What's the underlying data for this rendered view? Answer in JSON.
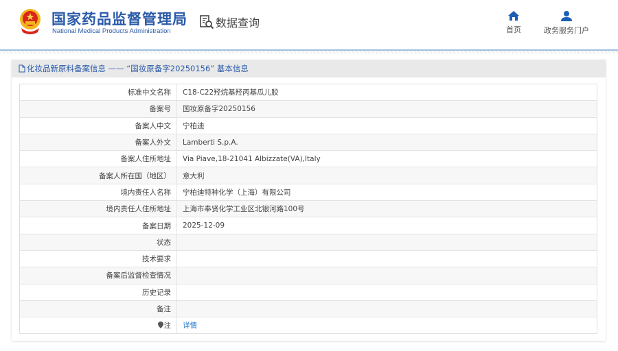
{
  "header": {
    "logo_cn": "国家药品监督管理局",
    "logo_en": "National Medical Products Administration",
    "query_label": "数据查询",
    "nav": [
      {
        "label": "首页",
        "icon": "home-icon"
      },
      {
        "label": "政务服务门户",
        "icon": "user-icon"
      }
    ]
  },
  "panel": {
    "title": "化妆品新原料备案信息 —— “国妆原备字20250156” 基本信息"
  },
  "rows": [
    {
      "label": "标准中文名称",
      "value": "C18-C22羟烷基羟丙基瓜儿胶"
    },
    {
      "label": "备案号",
      "value": "国妆原备字20250156"
    },
    {
      "label": "备案人中文",
      "value": "宁柏迪"
    },
    {
      "label": "备案人外文",
      "value": "Lamberti S.p.A."
    },
    {
      "label": "备案人住所地址",
      "value": "Via Piave,18-21041 Albizzate(VA),Italy"
    },
    {
      "label": "备案人所在国（地区）",
      "value": "意大利"
    },
    {
      "label": "境内责任人名称",
      "value": "宁柏迪特种化学（上海）有限公司"
    },
    {
      "label": "境内责任人住所地址",
      "value": "上海市奉贤化学工业区北银河路100号"
    },
    {
      "label": "备案日期",
      "value": "2025-12-09"
    },
    {
      "label": "状态",
      "value": ""
    },
    {
      "label": "技术要求",
      "value": ""
    },
    {
      "label": "备案后监督检查情况",
      "value": ""
    },
    {
      "label": "历史记录",
      "value": ""
    },
    {
      "label": "备注",
      "value": ""
    }
  ],
  "note_row": {
    "label": "注",
    "link": "详情"
  },
  "colors": {
    "brand": "#2a5aa8",
    "link": "#2a7fd4"
  }
}
